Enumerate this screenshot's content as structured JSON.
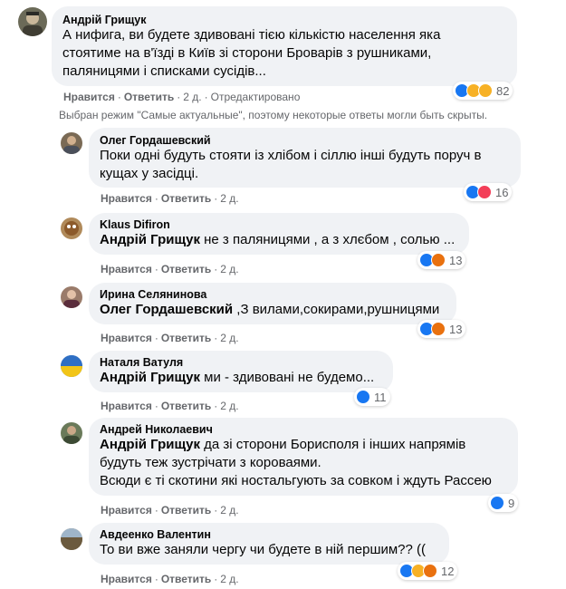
{
  "root_comment": {
    "author": "Андрій Грищук",
    "text_lines": [
      "А нифига, ви будете здивовані тією кількістю населення яка",
      "стоятиме на в'їзді в Київ зі сторони Броварів з рушниками,",
      "паляницями і списками сусідів..."
    ],
    "like_label": "Нравится",
    "reply_label": "Ответить",
    "time": "2 д.",
    "edited_label": "Отредактировано",
    "reaction_count": "82",
    "reaction_icons": [
      "like-icon",
      "haha-icon",
      "sad-icon"
    ]
  },
  "notice": "Выбран режим \"Самые актуальные\", поэтому некоторые ответы могли быть скрыты.",
  "replies": [
    {
      "author": "Олег Гордашевский",
      "text_lines": [
        "Поки одні будуть стояти із хлібом і сіллю інші будуть поруч в",
        "кущах у засідці."
      ],
      "like_label": "Нравится",
      "reply_label": "Ответить",
      "time": "2 д.",
      "reaction_count": "16",
      "reaction_icons": [
        "like-icon",
        "love-icon"
      ]
    },
    {
      "author": "Klaus Difiron",
      "tag": "Андрій Грищук",
      "text_lines": [
        " не з паляницями , а з хлєбом , солью ..."
      ],
      "like_label": "Нравится",
      "reply_label": "Ответить",
      "time": "2 д.",
      "reaction_count": "13",
      "reaction_icons": [
        "like-icon",
        "angry-icon"
      ]
    },
    {
      "author": "Ирина Селянинова",
      "tag": "Олег Гордашевский",
      "text_lines": [
        " ,З вилами,сокирами,рушницями"
      ],
      "like_label": "Нравится",
      "reply_label": "Ответить",
      "time": "2 д.",
      "reaction_count": "13",
      "reaction_icons": [
        "like-icon",
        "angry-icon"
      ]
    },
    {
      "author": "Наталя Ватуля",
      "tag": "Андрій Грищук",
      "text_lines": [
        " ми - здивовані не будемо..."
      ],
      "like_label": "Нравится",
      "reply_label": "Ответить",
      "time": "2 д.",
      "reaction_count": "11",
      "reaction_icons": [
        "like-icon"
      ]
    },
    {
      "author": "Андрей Николаевич",
      "tag": "Андрій Грищук",
      "text_lines": [
        " да зі сторони Борисполя і інших напрямів",
        "будуть теж зустрічати з короваями.",
        "Всюди є ті скотини які ностальгують за совком і ждуть Рассею"
      ],
      "like_label": "Нравится",
      "reply_label": "Ответить",
      "time": "2 д.",
      "reaction_count": "9",
      "reaction_icons": [
        "like-icon"
      ]
    },
    {
      "author": "Авдеенко Валентин",
      "text_lines": [
        "То ви вже заняли чергу чи будете в ній першим?? (("
      ],
      "like_label": "Нравится",
      "reply_label": "Ответить",
      "time": "2 д.",
      "reaction_count": "12",
      "reaction_icons": [
        "like-icon",
        "haha-icon",
        "angry-icon"
      ]
    }
  ],
  "colors": {
    "bubble_bg": "#f0f2f5",
    "secondary_text": "#65676b",
    "like_blue": "#1877f2",
    "love_red": "#f33e58",
    "haha_yellow": "#f7b125",
    "angry_orange": "#e9710f"
  }
}
